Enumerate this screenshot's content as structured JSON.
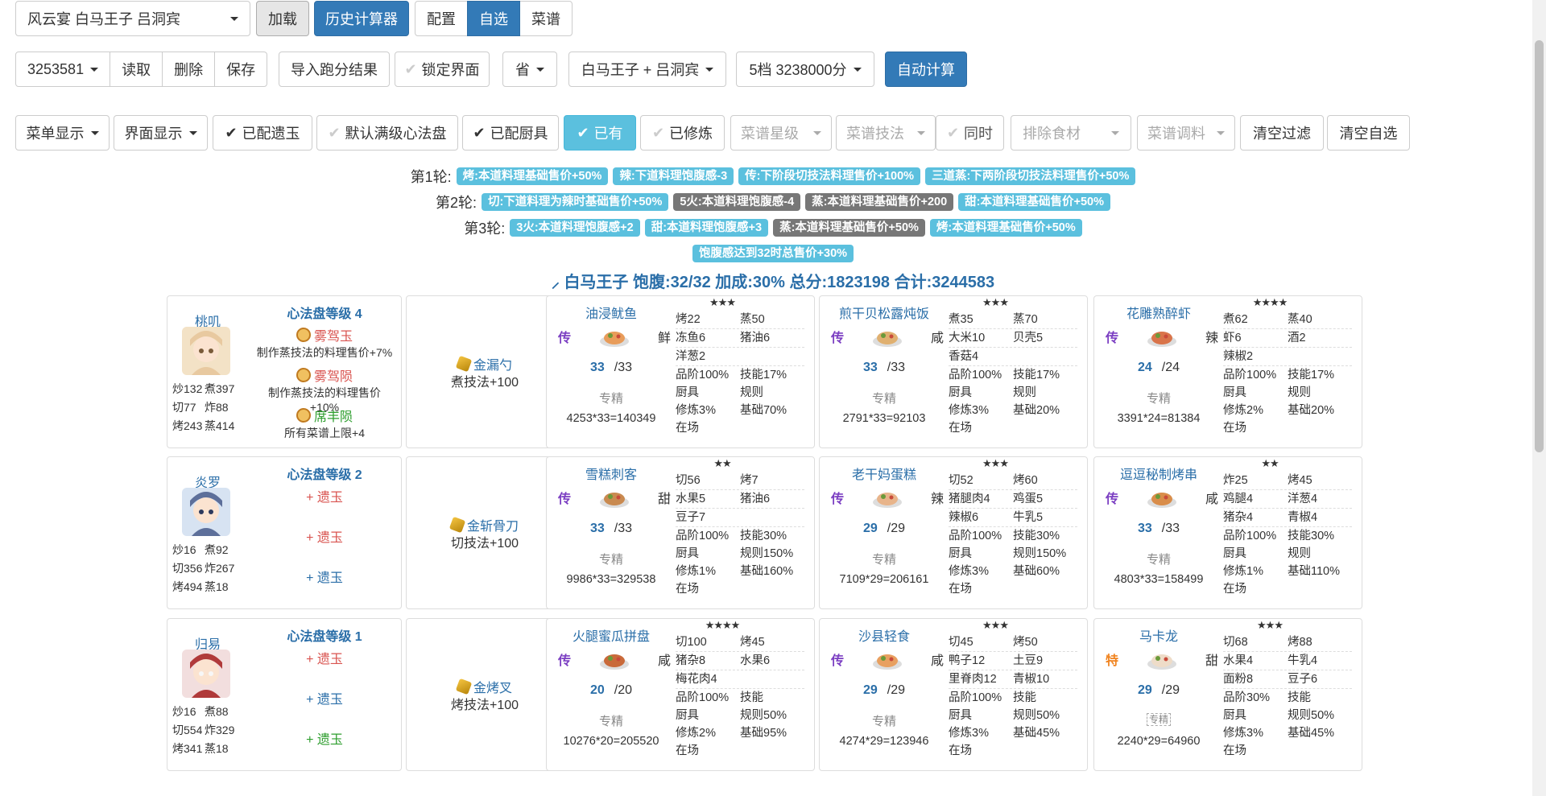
{
  "toolbar1": {
    "rule_select": "风云宴 白马王子 吕洞宾",
    "load": "加载",
    "history": "历史计算器",
    "config": "配置",
    "custom": "自选",
    "recipes": "菜谱"
  },
  "toolbar2": {
    "id": "3253581",
    "read": "读取",
    "delete": "删除",
    "save": "保存",
    "import": "导入跑分结果",
    "lock": "锁定界面",
    "province": "省",
    "guests": "白马王子 + 吕洞宾",
    "grade": "5档 3238000分",
    "auto": "自动计算"
  },
  "toolbar3": {
    "menu_display": "菜单显示",
    "ui_display": "界面显示",
    "has_amber": "已配遗玉",
    "default_disc": "默认满级心法盘",
    "has_equip": "已配厨具",
    "owned": "已有",
    "trained": "已修炼",
    "rarity": "菜谱星级",
    "skill": "菜谱技法",
    "same_time": "同时",
    "exclude": "排除食材",
    "condiment": "菜谱调料",
    "clear_filter": "清空过滤",
    "clear_custom": "清空自选"
  },
  "rounds": [
    {
      "label": "第1轮:",
      "tags": [
        {
          "text": "烤:本道料理基础售价+50%",
          "dark": false
        },
        {
          "text": "辣:下道料理饱腹感-3",
          "dark": false
        },
        {
          "text": "传:下阶段切技法料理售价+100%",
          "dark": false
        },
        {
          "text": "三道蒸:下两阶段切技法料理售价+50%",
          "dark": false
        }
      ]
    },
    {
      "label": "第2轮:",
      "tags": [
        {
          "text": "切:下道料理为辣时基础售价+50%",
          "dark": false
        },
        {
          "text": "5火:本道料理饱腹感-4",
          "dark": true
        },
        {
          "text": "蒸:本道料理基础售价+200",
          "dark": true
        },
        {
          "text": "甜:本道料理基础售价+50%",
          "dark": false
        }
      ]
    },
    {
      "label": "第3轮:",
      "tags": [
        {
          "text": "3火:本道料理饱腹感+2",
          "dark": false
        },
        {
          "text": "甜:本道料理饱腹感+3",
          "dark": false
        },
        {
          "text": "蒸:本道料理基础售价+50%",
          "dark": true
        },
        {
          "text": "烤:本道料理基础售价+50%",
          "dark": false
        }
      ]
    }
  ],
  "bonus_tag": "饱腹感达到32时总售价+30%",
  "summary": "白马王子 饱腹:32/32 加成:30% 总分:1823198 合计:3244583",
  "chefs": [
    {
      "name": "桃叽",
      "stats": [
        "炒132",
        "煮397",
        "切77",
        "炸88",
        "烤243",
        "蒸414"
      ],
      "disc": "心法盘等级 4",
      "ambers": [
        {
          "name": "雾驾玉",
          "desc": "制作蒸技法的料理售价+7%",
          "color": "red",
          "filled": true
        },
        {
          "name": "雾驾陨",
          "desc": "制作蒸技法的料理售价+10%",
          "color": "red",
          "filled": true
        },
        {
          "name": "席丰陨",
          "desc": "所有菜谱上限+4",
          "color": "green",
          "filled": true
        }
      ],
      "equip": {
        "name": "金漏勺",
        "desc": "煮技法+100"
      },
      "recipes": [
        {
          "name": "油浸鱿鱼",
          "stars": "★★★",
          "cond": "鲜",
          "rank": "传",
          "qty": "33",
          "max": "/33",
          "zj": "专精",
          "calc": "4253*33=140349",
          "cells": [
            "烤22",
            "蒸50",
            "冻鱼6",
            "猪油6",
            "洋葱2",
            "",
            "品阶100%",
            "技能17%",
            "厨具",
            "规则",
            "修炼3%",
            "基础70%",
            "在场",
            ""
          ]
        },
        {
          "name": "煎干贝松露炖饭",
          "stars": "★★★",
          "cond": "咸",
          "rank": "传",
          "qty": "33",
          "max": "/33",
          "zj": "专精",
          "calc": "2791*33=92103",
          "cells": [
            "煮35",
            "蒸70",
            "大米10",
            "贝壳5",
            "香菇4",
            "",
            "品阶100%",
            "技能17%",
            "厨具",
            "规则",
            "修炼3%",
            "基础20%",
            "在场",
            ""
          ]
        },
        {
          "name": "花雕熟醉虾",
          "stars": "★★★★",
          "cond": "辣",
          "rank": "传",
          "qty": "24",
          "max": "/24",
          "zj": "专精",
          "calc": "3391*24=81384",
          "cells": [
            "煮62",
            "蒸40",
            "虾6",
            "酒2",
            "辣椒2",
            "",
            "品阶100%",
            "技能17%",
            "厨具",
            "规则",
            "修炼2%",
            "基础20%",
            "在场",
            ""
          ]
        }
      ]
    },
    {
      "name": "炎罗",
      "stats": [
        "炒16",
        "煮92",
        "切356",
        "炸267",
        "烤494",
        "蒸18"
      ],
      "disc": "心法盘等级 2",
      "ambers": [
        {
          "name": "+ 遗玉",
          "desc": "",
          "color": "red",
          "filled": false
        },
        {
          "name": "+ 遗玉",
          "desc": "",
          "color": "red",
          "filled": false
        },
        {
          "name": "+ 遗玉",
          "desc": "",
          "color": "blue",
          "filled": false
        }
      ],
      "equip": {
        "name": "金斩骨刀",
        "desc": "切技法+100"
      },
      "recipes": [
        {
          "name": "雪糕刺客",
          "stars": "★★",
          "cond": "甜",
          "rank": "传",
          "qty": "33",
          "max": "/33",
          "zj": "专精",
          "calc": "9986*33=329538",
          "cells": [
            "切56",
            "烤7",
            "水果5",
            "猪油6",
            "豆子7",
            "",
            "品阶100%",
            "技能30%",
            "厨具",
            "规则150%",
            "修炼1%",
            "基础160%",
            "在场",
            ""
          ]
        },
        {
          "name": "老干妈蛋糕",
          "stars": "★★★",
          "cond": "辣",
          "rank": "传",
          "qty": "29",
          "max": "/29",
          "zj": "专精",
          "calc": "7109*29=206161",
          "cells": [
            "切52",
            "烤60",
            "猪腿肉4",
            "鸡蛋5",
            "辣椒6",
            "牛乳5",
            "品阶100%",
            "技能30%",
            "厨具",
            "规则150%",
            "修炼3%",
            "基础60%",
            "在场",
            ""
          ]
        },
        {
          "name": "逗逗秘制烤串",
          "stars": "★★",
          "cond": "咸",
          "rank": "传",
          "qty": "33",
          "max": "/33",
          "zj": "专精",
          "calc": "4803*33=158499",
          "cells": [
            "炸25",
            "烤45",
            "鸡腿4",
            "洋葱4",
            "猪杂4",
            "青椒4",
            "品阶100%",
            "技能30%",
            "厨具",
            "规则",
            "修炼1%",
            "基础110%",
            "在场",
            ""
          ]
        }
      ]
    },
    {
      "name": "归易",
      "stats": [
        "炒16",
        "煮88",
        "切554",
        "炸329",
        "烤341",
        "蒸18"
      ],
      "disc": "心法盘等级 1",
      "ambers": [
        {
          "name": "+ 遗玉",
          "desc": "",
          "color": "red",
          "filled": false
        },
        {
          "name": "+ 遗玉",
          "desc": "",
          "color": "blue",
          "filled": false
        },
        {
          "name": "+ 遗玉",
          "desc": "",
          "color": "green",
          "filled": false
        }
      ],
      "equip": {
        "name": "金烤叉",
        "desc": "烤技法+100"
      },
      "recipes": [
        {
          "name": "火腿蜜瓜拼盘",
          "stars": "★★★★",
          "cond": "咸",
          "rank": "传",
          "qty": "20",
          "max": "/20",
          "zj": "专精",
          "calc": "10276*20=205520",
          "cells": [
            "切100",
            "烤45",
            "猪杂8",
            "水果6",
            "梅花肉4",
            "",
            "品阶100%",
            "技能",
            "厨具",
            "规则50%",
            "修炼2%",
            "基础95%",
            "在场",
            ""
          ]
        },
        {
          "name": "沙县轻食",
          "stars": "★★★",
          "cond": "咸",
          "rank": "传",
          "qty": "29",
          "max": "/29",
          "zj": "专精",
          "calc": "4274*29=123946",
          "cells": [
            "切45",
            "烤50",
            "鸭子12",
            "土豆9",
            "里脊肉12",
            "青椒10",
            "品阶100%",
            "技能",
            "厨具",
            "规则50%",
            "修炼3%",
            "基础45%",
            "在场",
            ""
          ]
        },
        {
          "name": "马卡龙",
          "stars": "★★★",
          "cond": "甜",
          "rank": "特",
          "qty": "29",
          "max": "/29",
          "zj": "专精",
          "calc": "2240*29=64960",
          "cells": [
            "切68",
            "烤88",
            "水果4",
            "牛乳4",
            "面粉8",
            "豆子6",
            "品阶30%",
            "技能",
            "厨具",
            "规则50%",
            "修炼3%",
            "基础45%",
            "在场",
            ""
          ]
        }
      ]
    }
  ]
}
